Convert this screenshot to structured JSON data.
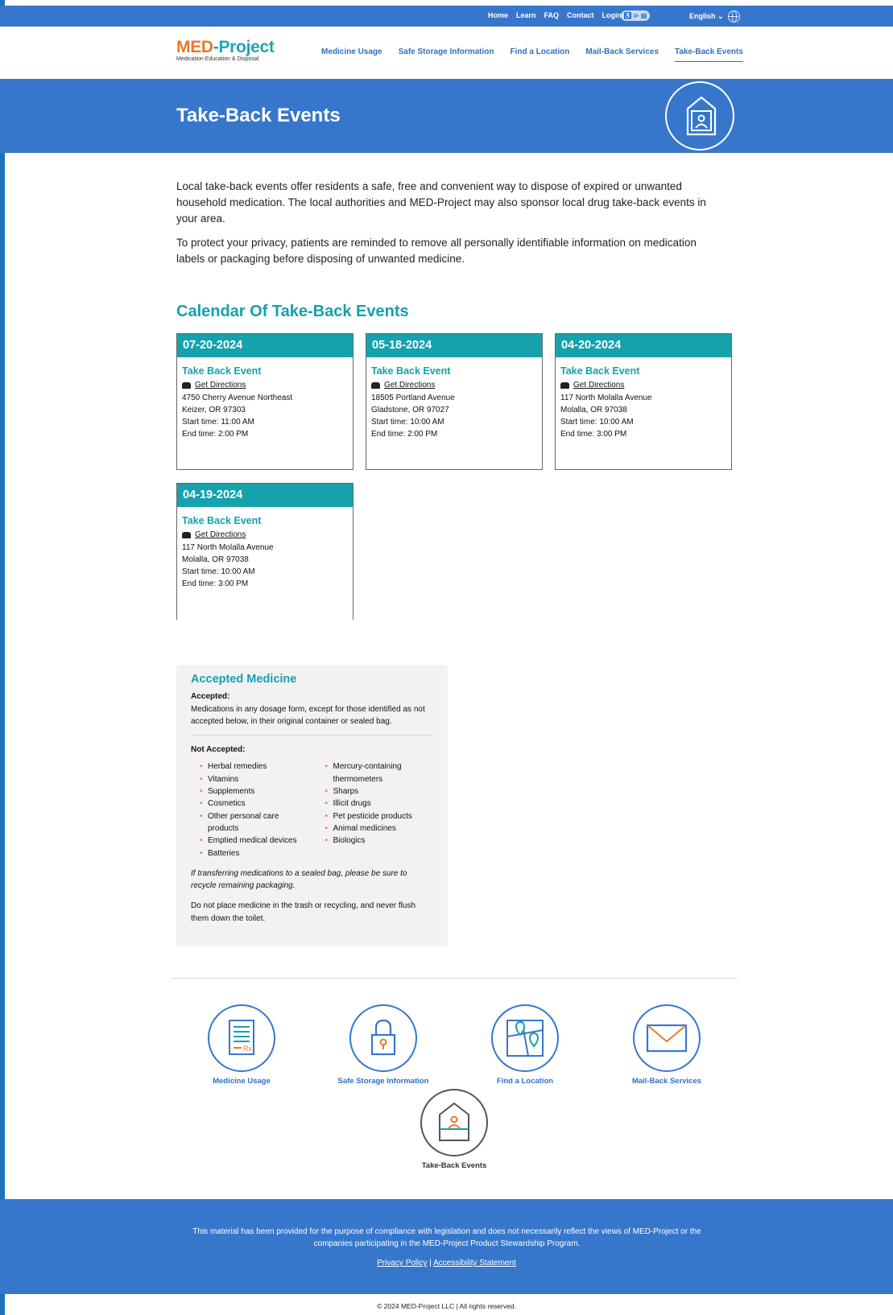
{
  "topbar": {
    "links": [
      "Home",
      "Learn",
      "FAQ",
      "Contact",
      "Login"
    ],
    "accessibility_label": "♿ ⊳ ▤",
    "language": "English ⌄"
  },
  "header": {
    "logo_med": "MED",
    "logo_dash": "-",
    "logo_project": "Project",
    "logo_tagline": "Medication Education & Disposal",
    "nav": [
      "Medicine Usage",
      "Safe Storage Information",
      "Find a Location",
      "Mail-Back Services",
      "Take-Back Events"
    ],
    "active_nav": "Take-Back Events"
  },
  "hero": {
    "title": "Take-Back Events"
  },
  "intro": {
    "p1": "Local take-back events offer residents a safe, free and convenient way to dispose of expired or unwanted household medication. The local authorities and MED-Project may also sponsor local drug take-back events in your area.",
    "p2": "To protect your privacy, patients are reminded to remove all personally identifiable information on medication labels or packaging before disposing of unwanted medicine."
  },
  "calendar": {
    "title": "Calendar Of Take-Back Events",
    "events": [
      {
        "date": "07-20-2024",
        "title": "Take Back Event",
        "directions": "Get Directions",
        "street": "4750 Cherry Avenue Northeast",
        "city": "Keizer, OR 97303",
        "start": "Start time: 11:00 AM",
        "end": "End time: 2:00 PM"
      },
      {
        "date": "05-18-2024",
        "title": "Take Back Event",
        "directions": "Get Directions",
        "street": "18505 Portland Avenue",
        "city": "Gladstone, OR 97027",
        "start": "Start time: 10:00 AM",
        "end": "End time: 2:00 PM"
      },
      {
        "date": "04-20-2024",
        "title": "Take Back Event",
        "directions": "Get Directions",
        "street": "117 North Molalla Avenue",
        "city": "Molalla, OR 97038",
        "start": "Start time: 10:00 AM",
        "end": "End time: 3:00 PM"
      },
      {
        "date": "04-19-2024",
        "title": "Take Back Event",
        "directions": "Get Directions",
        "street": "117 North Molalla Avenue",
        "city": "Molalla, OR 97038",
        "start": "Start time: 10:00 AM",
        "end": "End time: 3:00 PM"
      }
    ]
  },
  "accepted": {
    "title": "Accepted Medicine",
    "accepted_label": "Accepted:",
    "accepted_text": "Medications in any dosage form, except for those identified as not accepted below, in their original container or sealed bag.",
    "not_accepted_label": "Not Accepted:",
    "col1": [
      "Herbal remedies",
      "Vitamins",
      "Supplements",
      "Cosmetics",
      "Other personal care products",
      "Emptied medical devices",
      "Batteries"
    ],
    "col2": [
      "Mercury-containing thermometers",
      "Sharps",
      "Illicit drugs",
      "Pet pesticide products",
      "Animal medicines",
      "Biologics"
    ],
    "italic_note": "If transferring medications to a sealed bag, please be sure to recycle remaining packaging.",
    "note": "Do not place medicine in the trash or recycling, and never flush them down the toilet."
  },
  "bottom_nav": {
    "medicine_usage": "Medicine Usage",
    "safe_storage": "Safe Storage Information",
    "find_location": "Find a Location",
    "mail_back": "Mail-Back Services",
    "take_back": "Take-Back Events"
  },
  "footer": {
    "disclaimer": "This material has been provided for the purpose of compliance with legislation and does not necessarily reflect the views of MED-Project or the companies participating in the MED-Project Product Stewardship Program.",
    "privacy": "Privacy Policy",
    "separator": "|",
    "accessibility": "Accessibility Statement",
    "copyright": "© 2024 MED-Project LLC | All rights reserved."
  },
  "colors": {
    "primary_blue": "#3777cb",
    "teal": "#16a2ad",
    "orange": "#e8792b"
  }
}
